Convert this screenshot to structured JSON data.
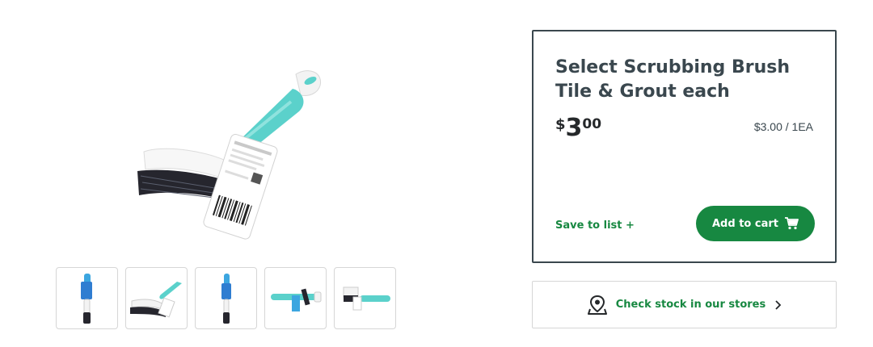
{
  "product": {
    "title": "Select Scrubbing Brush Tile & Grout each",
    "price_symbol": "$",
    "price_whole": "3",
    "price_cents": "00",
    "unit_price": "$3.00 / 1EA",
    "image_alt": "Select Scrubbing Brush Tile & Grout"
  },
  "actions": {
    "save_to_list": "Save to list +",
    "add_to_cart": "Add to cart",
    "check_stock": "Check stock in our stores"
  },
  "gallery": {
    "thumbnails": [
      "brush-front-packaged",
      "brush-angle",
      "brush-side",
      "brush-top",
      "brush-back"
    ]
  },
  "icons": {
    "cart": "shopping-cart-icon",
    "location": "map-pin-icon",
    "chevron": "chevron-right-icon"
  },
  "colors": {
    "brand_green": "#178841",
    "panel_border": "#3a474e",
    "accent_teal": "#5bd1cb"
  }
}
